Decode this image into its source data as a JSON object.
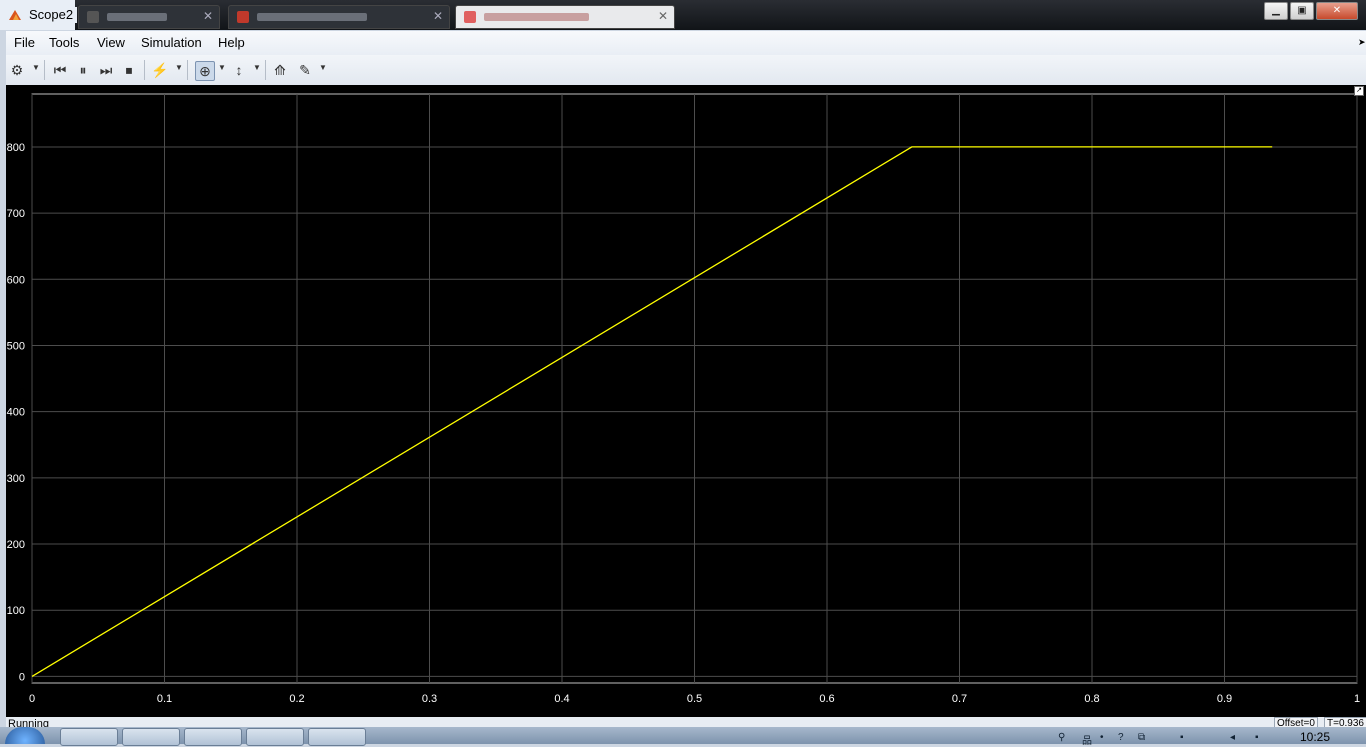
{
  "window": {
    "title": "Scope2"
  },
  "menu": {
    "items": [
      "File",
      "Tools",
      "View",
      "Simulation",
      "Help"
    ]
  },
  "toolbar": {
    "icons": [
      "gear-icon",
      "step-back-icon",
      "pause-icon",
      "step-forward-icon",
      "stop-icon",
      "highlight-icon",
      "zoom-icon",
      "scale-axes-icon",
      "cursor-measure-icon",
      "style-icon"
    ]
  },
  "status": {
    "text": "Running",
    "offset": "Offset=0",
    "time": "T=0.936"
  },
  "taskbar": {
    "clock": "10:25"
  },
  "colors": {
    "plot_bg": "#000000",
    "grid": "#4d4d4d",
    "trace": "#ffff00",
    "tick_text": "#ffffff"
  },
  "chart_data": {
    "type": "line",
    "title": "",
    "xlabel": "",
    "ylabel": "",
    "xlim": [
      0,
      1
    ],
    "ylim": [
      -10,
      880
    ],
    "xticks": [
      "0",
      "0.1",
      "0.2",
      "0.3",
      "0.4",
      "0.5",
      "0.6",
      "0.7",
      "0.8",
      "0.9",
      "1"
    ],
    "yticks": [
      "0",
      "100",
      "200",
      "300",
      "400",
      "500",
      "600",
      "700",
      "800"
    ],
    "grid": true,
    "series": [
      {
        "x": [
          0,
          0.664,
          0.936
        ],
        "y": [
          0,
          800,
          800
        ]
      }
    ]
  }
}
